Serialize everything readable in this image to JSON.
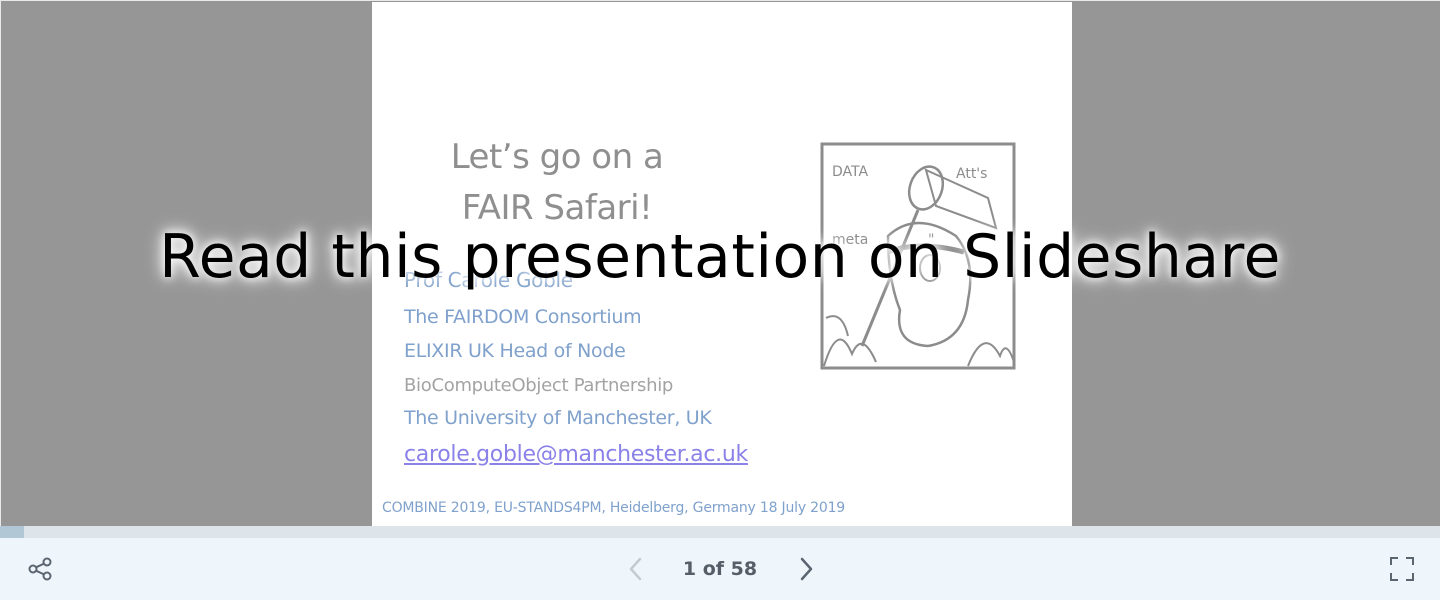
{
  "slide": {
    "title_lines": [
      "Let’s go on a",
      "FAIR Safari!"
    ],
    "author": "Prof Carole Goble",
    "affiliations": [
      "The FAIRDOM Consortium",
      "ELIXIR UK Head of Node",
      "BioComputeObject Partnership",
      "The University of Manchester, UK"
    ],
    "email": "carole.goble@manchester.ac.uk",
    "footer": "COMBINE 2019, EU-STANDS4PM, Heidelberg, Germany 18 July 2019",
    "cartoon": {
      "labels": [
        "DATA",
        "Att's",
        "meta",
        "\""
      ],
      "icon": "safari-cartoon-icon"
    }
  },
  "overlay": {
    "text": "Read this presentation on Slideshare"
  },
  "progress": {
    "current": 1,
    "total": 58,
    "fraction": 0.017
  },
  "controls": {
    "page_label": "1 of 58",
    "share_icon": "share-icon",
    "prev_icon": "chevron-left-icon",
    "next_icon": "chevron-right-icon",
    "fullscreen_icon": "fullscreen-icon"
  },
  "colors": {
    "background": "#969696",
    "slide_text_blue": "#7fa1cc",
    "slide_title_grey": "#8f8f8f",
    "link_purple": "#8a82e8",
    "controls_bg": "#eef6fb",
    "progress_fill": "#b2c7d6"
  }
}
